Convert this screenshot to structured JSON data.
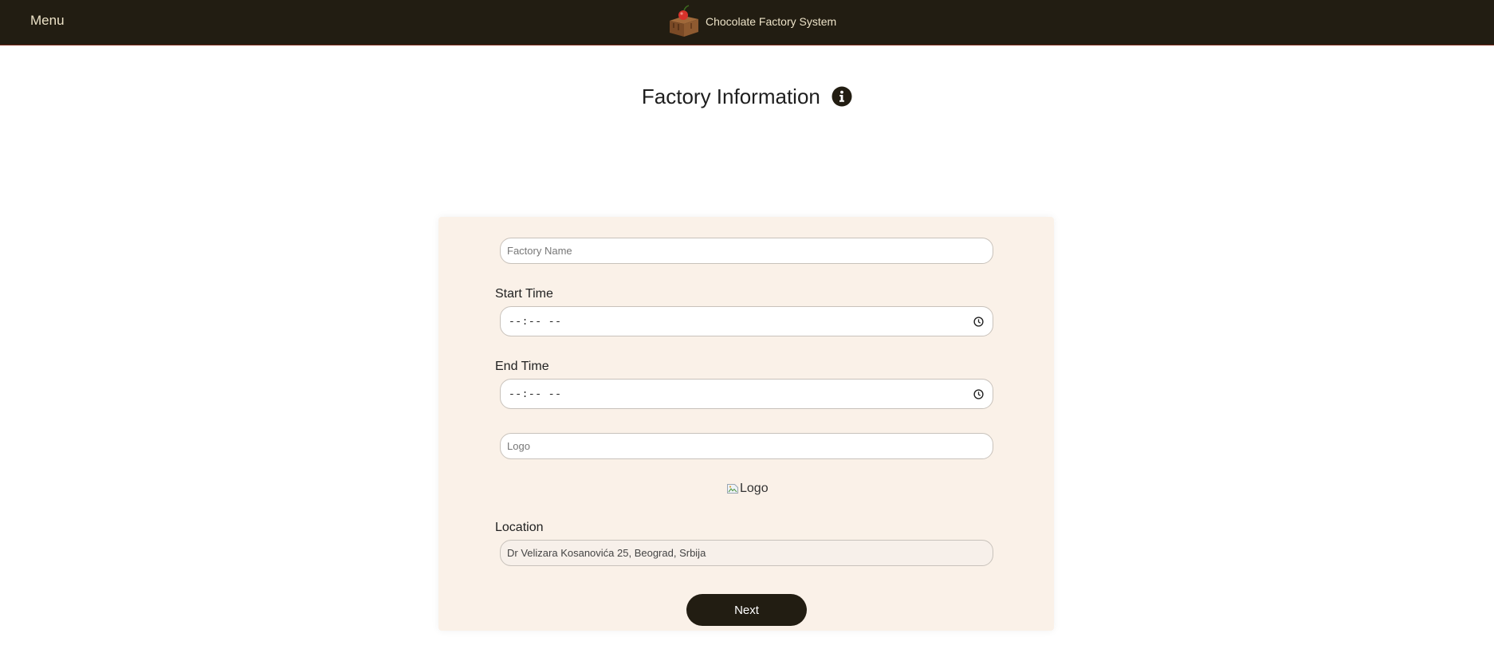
{
  "header": {
    "menu_label": "Menu",
    "brand_title": "Chocolate Factory System",
    "brand_logo_icon": "cake-with-cherry-icon",
    "background_color": "#221d12",
    "text_color": "#ece2c7"
  },
  "page": {
    "title": "Factory Information",
    "info_icon": "info-circle-icon"
  },
  "form": {
    "factory_name": {
      "placeholder": "Factory Name",
      "value": ""
    },
    "start_time": {
      "label": "Start Time",
      "display": "--:-- --",
      "icon": "clock-icon"
    },
    "end_time": {
      "label": "End Time",
      "display": "--:-- --",
      "icon": "clock-icon"
    },
    "logo": {
      "placeholder": "Logo",
      "value": ""
    },
    "logo_preview": {
      "alt_text": "Logo",
      "icon": "broken-image-icon"
    },
    "location": {
      "label": "Location",
      "value": "Dr Velizara Kosanovića 25, Beograd, Srbija"
    },
    "next_label": "Next",
    "card_color": "#faf1e8",
    "button_color": "#221d12"
  }
}
